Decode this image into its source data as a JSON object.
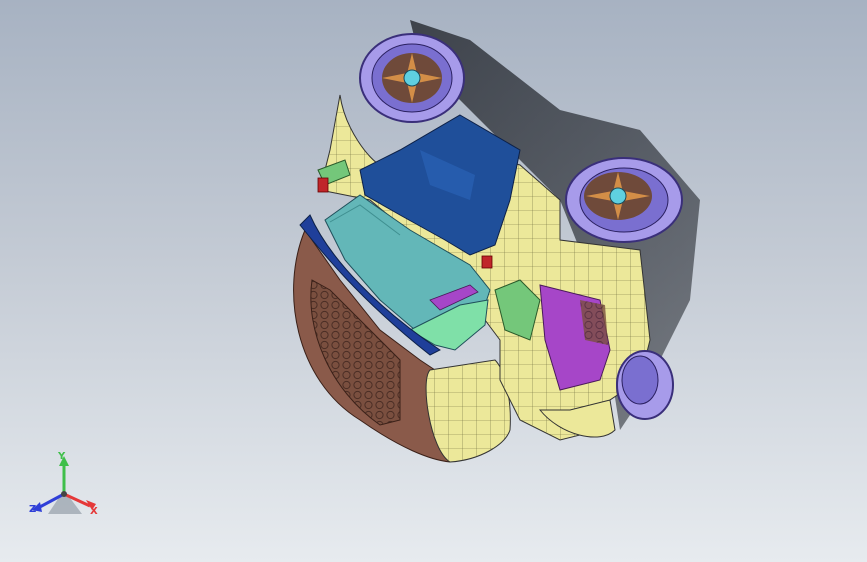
{
  "viewport": {
    "background_top": "#a7b2c2",
    "background_bottom": "#e7ebef"
  },
  "model": {
    "description_icon": "car-body-model",
    "colors": {
      "yellow": "#ece89a",
      "blue": "#1f4f9a",
      "cyan": "#63b7b8",
      "brown": "#8a5a4a",
      "purple": "#a646c8",
      "lavender": "#a79bea",
      "green": "#74c77a",
      "red": "#c0262a"
    }
  },
  "triad": {
    "x_label": "X",
    "y_label": "Y",
    "z_label": "Z",
    "x_color": "#e53838",
    "y_color": "#3fbf4a",
    "z_color": "#2f3fd8"
  }
}
